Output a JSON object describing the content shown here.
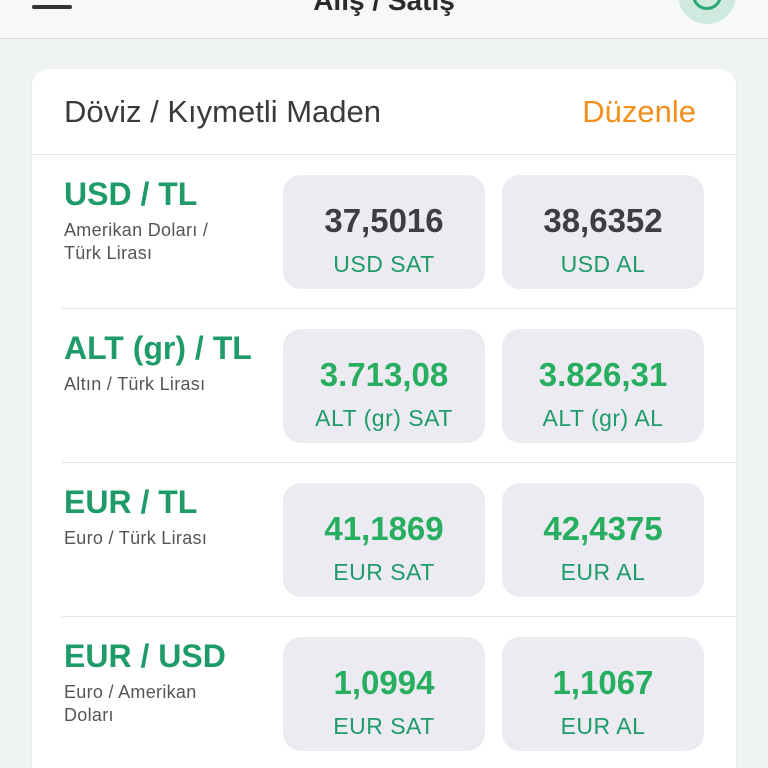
{
  "navbar": {
    "title": "Alış / Satış"
  },
  "colors": {
    "accent_green": "#1f9b6a",
    "edit_orange": "#f2901e",
    "value_neutral": "#3d3d45",
    "value_up": "#27ae60"
  },
  "card": {
    "title": "Döviz / Kıymetli Maden",
    "edit_label": "Düzenle"
  },
  "rows": [
    {
      "pair": "USD / TL",
      "description": "Amerikan Doları / Türk Lirası",
      "sell_value": "37,5016",
      "sell_label": "USD SAT",
      "buy_value": "38,6352",
      "buy_label": "USD AL",
      "trend": "neutral"
    },
    {
      "pair": "ALT (gr) / TL",
      "description": "Altın / Türk Lirası",
      "sell_value": "3.713,08",
      "sell_label": "ALT (gr) SAT",
      "buy_value": "3.826,31",
      "buy_label": "ALT (gr) AL",
      "trend": "up"
    },
    {
      "pair": "EUR / TL",
      "description": "Euro / Türk Lirası",
      "sell_value": "41,1869",
      "sell_label": "EUR SAT",
      "buy_value": "42,4375",
      "buy_label": "EUR AL",
      "trend": "up"
    },
    {
      "pair": "EUR / USD",
      "description": "Euro / Amerikan Doları",
      "sell_value": "1,0994",
      "sell_label": "EUR SAT",
      "buy_value": "1,1067",
      "buy_label": "EUR AL",
      "trend": "up"
    }
  ]
}
